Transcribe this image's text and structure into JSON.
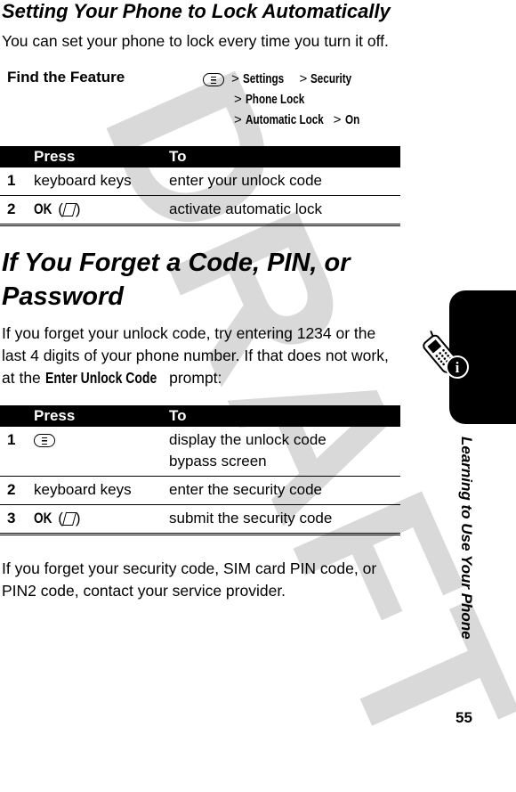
{
  "watermark": "DRAFT",
  "section1": {
    "title": "Setting Your Phone to Lock Automatically",
    "intro": "You can set your phone to lock every time you turn it off.",
    "find_feature": {
      "label": "Find the Feature",
      "icon": "menu-key-icon",
      "path": [
        {
          "sep": ">",
          "item": "Settings"
        },
        {
          "sep": ">",
          "item": "Security"
        },
        {
          "sep": ">",
          "item": "Phone Lock"
        },
        {
          "sep": ">",
          "item": "Automatic Lock"
        },
        {
          "sep": ">",
          "item": "On"
        }
      ]
    },
    "table": {
      "headers": [
        "",
        "Press",
        "To"
      ],
      "rows": [
        {
          "num": "1",
          "press": "keyboard keys",
          "to": "enter your unlock code"
        },
        {
          "num": "2",
          "press_ok": "OK",
          "press_icon": "soft-key-icon",
          "to": "activate automatic lock"
        }
      ]
    }
  },
  "section2": {
    "title": "If You Forget a Code, PIN, or Password",
    "para1_before": "If you forget your unlock code, try entering 1234 or the last 4 digits of your phone number. If that does not work, at the ",
    "para1_prompt": "Enter Unlock Code",
    "para1_after": " prompt:",
    "table": {
      "headers": [
        "",
        "Press",
        "To"
      ],
      "rows": [
        {
          "num": "1",
          "press_icon": "menu-key-icon",
          "to": "display the unlock code bypass screen"
        },
        {
          "num": "2",
          "press": "keyboard keys",
          "to": "enter the security code"
        },
        {
          "num": "3",
          "press_ok": "OK",
          "press_icon": "soft-key-icon",
          "to": "submit the security code"
        }
      ]
    },
    "para2": "If you forget your security code, SIM card PIN code, or PIN2 code, contact your service provider."
  },
  "side_tab": {
    "icon": "phone-info-icon",
    "label": "Learning to Use Your Phone"
  },
  "page_number": "55"
}
